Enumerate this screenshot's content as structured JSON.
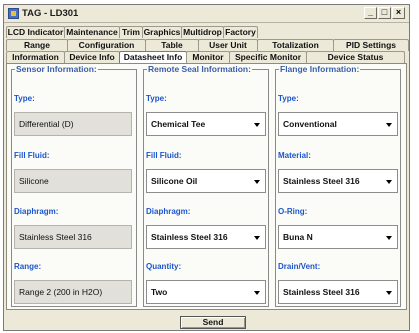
{
  "window": {
    "title": "TAG - LD301"
  },
  "tabs": {
    "row1": [
      "LCD Indicator",
      "Maintenance",
      "Trim",
      "Graphics",
      "Multidrop",
      "Factory"
    ],
    "row2": [
      "Range",
      "Configuration",
      "Table",
      "User Unit",
      "Totalization",
      "PID Settings"
    ],
    "row3": [
      "Information",
      "Device Info",
      "Datasheet Info",
      "Monitor",
      "Specific Monitor",
      "Device Status"
    ],
    "selected": "Datasheet Info"
  },
  "sensor": {
    "title": "Sensor Information:",
    "type_label": "Type:",
    "type_value": "Differential (D)",
    "fill_label": "Fill Fluid:",
    "fill_value": "Silicone",
    "diaphragm_label": "Diaphragm:",
    "diaphragm_value": "Stainless Steel 316",
    "range_label": "Range:",
    "range_value": "Range 2 (200 in H2O)"
  },
  "remote_seal": {
    "title": "Remote Seal Information:",
    "type_label": "Type:",
    "type_value": "Chemical Tee",
    "fill_label": "Fill Fluid:",
    "fill_value": "Silicone Oil",
    "diaphragm_label": "Diaphragm:",
    "diaphragm_value": "Stainless Steel 316",
    "quantity_label": "Quantity:",
    "quantity_value": "Two"
  },
  "flange": {
    "title": "Flange Information:",
    "type_label": "Type:",
    "type_value": "Conventional",
    "material_label": "Material:",
    "material_value": "Stainless Steel 316",
    "oring_label": "O-Ring:",
    "oring_value": "Buna N",
    "drain_label": "Drain/Vent:",
    "drain_value": "Stainless Steel 316"
  },
  "buttons": {
    "send": "Send"
  }
}
